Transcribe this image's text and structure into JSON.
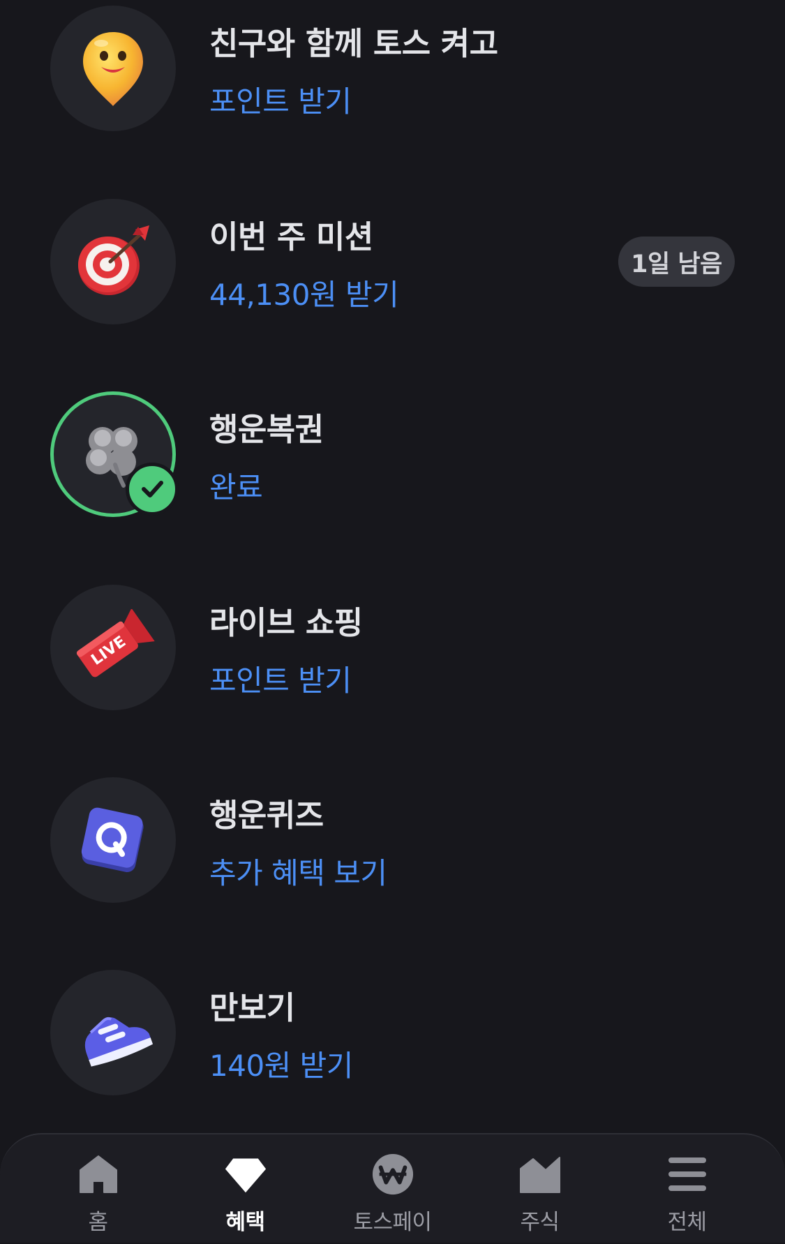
{
  "benefits": [
    {
      "title": "친구와 함께 토스 켜고",
      "action": "포인트 받기",
      "icon": "smiley-pin-icon"
    },
    {
      "title": "이번 주 미션",
      "action": "44,130원 받기",
      "icon": "target-dart-icon",
      "badge": "1일 남음"
    },
    {
      "title": "행운복권",
      "action": "완료",
      "icon": "clover-icon",
      "completed": true
    },
    {
      "title": "라이브 쇼핑",
      "action": "포인트 받기",
      "icon": "live-megaphone-icon"
    },
    {
      "title": "행운퀴즈",
      "action": "추가 혜택 보기",
      "icon": "quiz-q-block-icon"
    },
    {
      "title": "만보기",
      "action": "140원 받기",
      "icon": "sneaker-icon"
    }
  ],
  "nav": {
    "items": [
      {
        "label": "홈",
        "icon": "home-icon"
      },
      {
        "label": "혜택",
        "icon": "gem-icon",
        "active": true
      },
      {
        "label": "토스페이",
        "icon": "won-coin-icon"
      },
      {
        "label": "주식",
        "icon": "stock-chart-icon"
      },
      {
        "label": "전체",
        "icon": "menu-icon"
      }
    ]
  },
  "colors": {
    "background": "#17171c",
    "icon_circle": "#24252b",
    "title_text": "#e4e5e9",
    "action_blue": "#4c8ff5",
    "success_green": "#4fcb7c",
    "badge_bg": "#34353c",
    "nav_bg": "#1d1d23",
    "nav_inactive": "#9c9da5"
  }
}
